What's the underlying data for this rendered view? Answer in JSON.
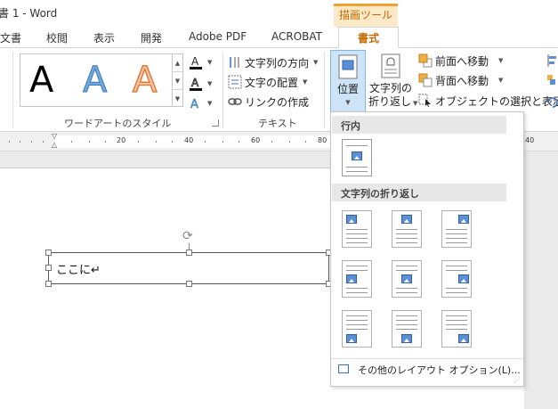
{
  "window": {
    "title": "書 1 - Word"
  },
  "context_tab": {
    "label": "描画ツール"
  },
  "tabs": [
    {
      "label": "文書"
    },
    {
      "label": "校閲"
    },
    {
      "label": "表示"
    },
    {
      "label": "開発"
    },
    {
      "label": "Adobe  PDF"
    },
    {
      "label": "ACROBAT"
    },
    {
      "label": "書式",
      "active": true
    }
  ],
  "ribbon": {
    "wordart": {
      "group_label": "ワードアートのスタイル",
      "sample_glyph": "A"
    },
    "text": {
      "group_label": "テキスト",
      "direction_label": "文字列の方向",
      "align_label": "文字の配置",
      "link_label": "リンクの作成"
    },
    "arrange": {
      "position_label": "位置",
      "wrap_label_line1": "文字列の",
      "wrap_label_line2": "折り返し",
      "bring_forward_label": "前面へ移動",
      "send_backward_label": "背面へ移動",
      "selection_pane_label": "オブジェクトの選択と表示"
    }
  },
  "ruler": {
    "labels": [
      "20",
      "40",
      "60",
      "80",
      "40"
    ]
  },
  "document": {
    "textbox_text": "ここに↵"
  },
  "dropdown": {
    "section_inline": "行内",
    "section_wrap": "文字列の折り返し",
    "footer_label": "その他のレイアウト オプション(L)..."
  },
  "colors": {
    "accent": "#c46a00",
    "context_tab_bg": "#fbe9c8",
    "pressed_bg": "#cde3f7",
    "picture_blue": "#5b8fd6"
  }
}
